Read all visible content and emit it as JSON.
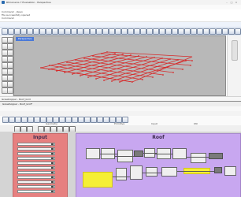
{
  "app": {
    "title": "Rhinoceros 7 Evaluation - Perspective"
  },
  "menus": [
    "File",
    "Edit",
    "View",
    "Curve",
    "Surface",
    "SubD",
    "Solid",
    "Mesh",
    "Dimension",
    "Transform",
    "Tools",
    "Analyze",
    "Render",
    "Panels",
    "Help"
  ],
  "command": {
    "line1": "Command: _Open",
    "line2": "File successfully opened",
    "line3": "Command:"
  },
  "toolbar_tabs": [
    "Standard",
    "CPlanes",
    "Set View",
    "Display",
    "Select",
    "Viewport Layout",
    "Visibility",
    "Transform",
    "Curve Tools",
    "Surface Tools",
    "Solid Tools",
    "SubD Tools",
    "Mesh Tools",
    "Render Tools",
    "Drafting"
  ],
  "viewport": {
    "label": "Perspective"
  },
  "status": {
    "text": "Grasshopper - Roof_Grid"
  },
  "grasshopper": {
    "title": "Grasshopper - Roof_Grid*",
    "menus": [
      "File",
      "Edit",
      "View",
      "Display",
      "Solution",
      "Help"
    ],
    "tabs": [
      "Params",
      "Maths",
      "Sets",
      "Vector",
      "Curve",
      "Surface",
      "Mesh",
      "Intersect",
      "Transform",
      "Display"
    ],
    "ribbon_sections": [
      "Geometry",
      "Primitive",
      "Input",
      "Util"
    ],
    "groups": {
      "input": "Input",
      "roof": "Roof"
    }
  }
}
